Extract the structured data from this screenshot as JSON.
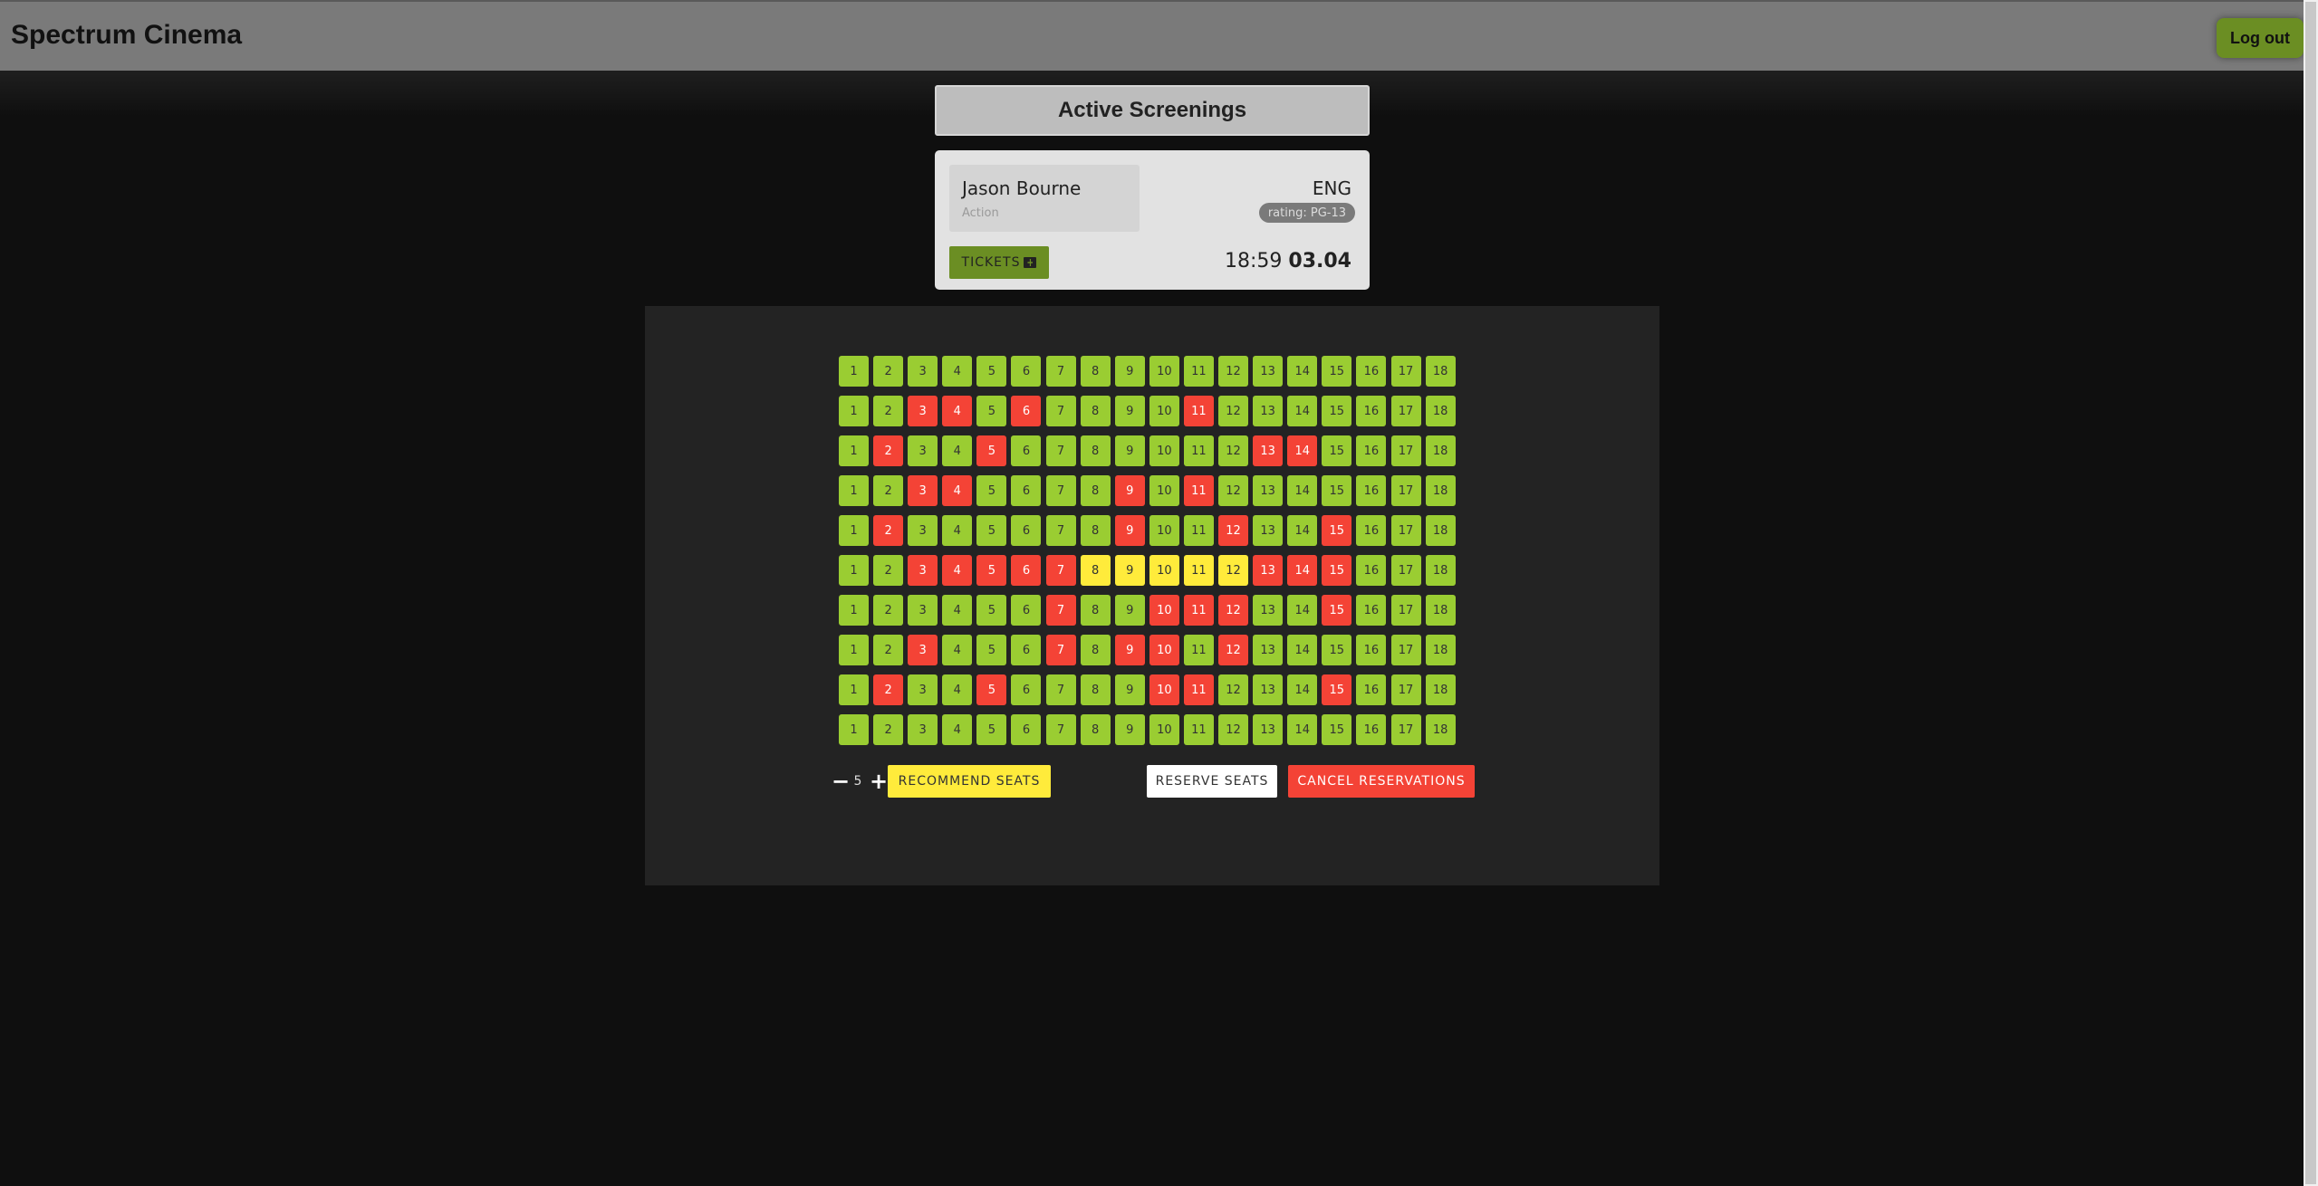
{
  "app": {
    "title": "Spectrum Cinema",
    "logout_label": "Log out"
  },
  "screenings": {
    "header": "Active Screenings",
    "card": {
      "movie_title": "Jason Bourne",
      "genre": "Action",
      "language": "ENG",
      "rating": "rating: PG-13",
      "tickets_label": "TICKETS",
      "time": "18:59",
      "date": "03.04"
    }
  },
  "seating": {
    "rows": [
      [
        "free",
        "free",
        "free",
        "free",
        "free",
        "free",
        "free",
        "free",
        "free",
        "free",
        "free",
        "free",
        "free",
        "free",
        "free",
        "free",
        "free",
        "free"
      ],
      [
        "free",
        "free",
        "taken",
        "taken",
        "free",
        "taken",
        "free",
        "free",
        "free",
        "free",
        "taken",
        "free",
        "free",
        "free",
        "free",
        "free",
        "free",
        "free"
      ],
      [
        "free",
        "taken",
        "free",
        "free",
        "taken",
        "free",
        "free",
        "free",
        "free",
        "free",
        "free",
        "free",
        "taken",
        "taken",
        "free",
        "free",
        "free",
        "free"
      ],
      [
        "free",
        "free",
        "taken",
        "taken",
        "free",
        "free",
        "free",
        "free",
        "taken",
        "free",
        "taken",
        "free",
        "free",
        "free",
        "free",
        "free",
        "free",
        "free"
      ],
      [
        "free",
        "taken",
        "free",
        "free",
        "free",
        "free",
        "free",
        "free",
        "taken",
        "free",
        "free",
        "taken",
        "free",
        "free",
        "taken",
        "free",
        "free",
        "free"
      ],
      [
        "free",
        "free",
        "taken",
        "taken",
        "taken",
        "taken",
        "taken",
        "recommended",
        "recommended",
        "recommended",
        "recommended",
        "recommended",
        "taken",
        "taken",
        "taken",
        "free",
        "free",
        "free"
      ],
      [
        "free",
        "free",
        "free",
        "free",
        "free",
        "free",
        "taken",
        "free",
        "free",
        "taken",
        "taken",
        "taken",
        "free",
        "free",
        "taken",
        "free",
        "free",
        "free"
      ],
      [
        "free",
        "free",
        "taken",
        "free",
        "free",
        "free",
        "taken",
        "free",
        "taken",
        "taken",
        "free",
        "taken",
        "free",
        "free",
        "free",
        "free",
        "free",
        "free"
      ],
      [
        "free",
        "taken",
        "free",
        "free",
        "taken",
        "free",
        "free",
        "free",
        "free",
        "taken",
        "taken",
        "free",
        "free",
        "free",
        "taken",
        "free",
        "free",
        "free"
      ],
      [
        "free",
        "free",
        "free",
        "free",
        "free",
        "free",
        "free",
        "free",
        "free",
        "free",
        "free",
        "free",
        "free",
        "free",
        "free",
        "free",
        "free",
        "free"
      ]
    ],
    "seat_count": 5,
    "minus_label": "−",
    "plus_label": "+",
    "recommend_label": "RECOMMEND SEATS",
    "reserve_label": "RESERVE SEATS",
    "cancel_label": "CANCEL RESERVATIONS",
    "colors": {
      "free": "#9acd32",
      "taken": "#f44336",
      "recommended": "#ffeb3b"
    }
  }
}
